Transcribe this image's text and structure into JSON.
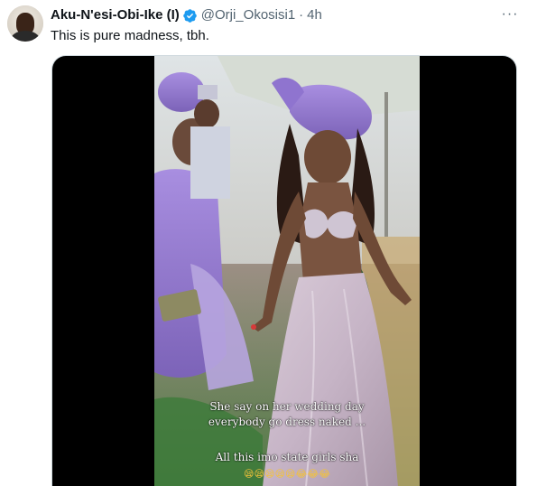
{
  "author": {
    "display_name": "Aku-N'esi-Obi-Ike (I)",
    "handle": "@Orji_Okosisi1",
    "separator": "·",
    "time": "4h",
    "verified_color": "#1d9bf0"
  },
  "more_button": {
    "label": "···"
  },
  "tweet": {
    "text": "This is pure madness, tbh."
  },
  "video": {
    "caption_line1": "She say on her wedding day",
    "caption_line2": "everybody go dress naked ...",
    "caption_line3": "All this imo state girls sha",
    "emojis": "😪😪😪😪😪😂😂😂"
  },
  "colors": {
    "text_primary": "#0f1419",
    "text_secondary": "#536471",
    "accent_lavender": "#9b7fd6"
  }
}
